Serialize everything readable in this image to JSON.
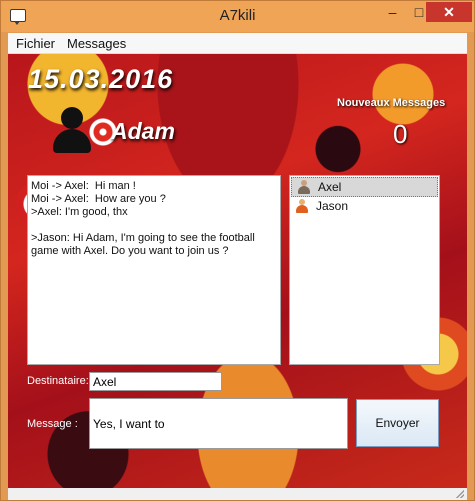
{
  "window": {
    "title": "A7kili",
    "minimize_glyph": "–",
    "maximize_glyph": "□",
    "close_glyph": "✕"
  },
  "menu": {
    "items": [
      {
        "label": "Fichier"
      },
      {
        "label": "Messages"
      }
    ]
  },
  "header": {
    "date": "15.03.2016",
    "username": "Adam",
    "new_messages_label": "Nouveaux Messages",
    "new_messages_count": "0"
  },
  "chat": {
    "lines": [
      "Moi -> Axel:  Hi man !",
      "Moi -> Axel:  How are you ?",
      ">Axel: I'm good, thx",
      "",
      ">Jason: Hi Adam, I'm going to see the football game with Axel. Do you want to join us ?"
    ]
  },
  "contacts": {
    "items": [
      {
        "name": "Axel",
        "selected": true
      },
      {
        "name": "Jason",
        "selected": false
      }
    ]
  },
  "compose": {
    "recipient_label": "Destinataire:",
    "recipient_value": "Axel",
    "message_label": "Message  :",
    "message_value": "Yes, I want to",
    "send_label": "Envoyer"
  },
  "colors": {
    "titlebar": "#f0a456",
    "close_button": "#c7352d",
    "background_red": "#c8261c"
  }
}
